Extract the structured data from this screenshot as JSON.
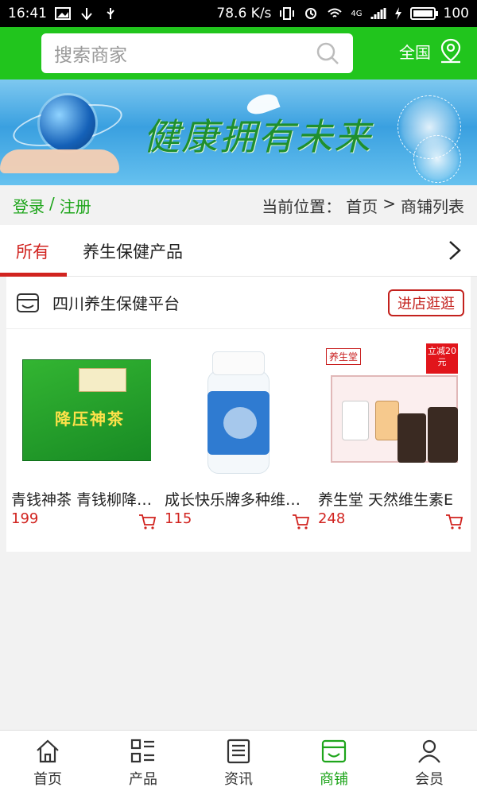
{
  "status_bar": {
    "time": "16:41",
    "speed": "78.6 K/s",
    "network": "4G",
    "battery": "100"
  },
  "header": {
    "search_placeholder": "搜索商家",
    "region_label": "全国"
  },
  "banner": {
    "slogan": "健康拥有未来"
  },
  "breadcrumb": {
    "login": "登录",
    "separator": "/",
    "register": "注册",
    "location_label": "当前位置：",
    "home": "首页",
    "arrow": ">",
    "current": "商铺列表"
  },
  "tabs": [
    {
      "label": "所有",
      "active": true
    },
    {
      "label": "养生保健产品",
      "active": false
    }
  ],
  "shop": {
    "name": "四川养生保健平台",
    "enter_button": "进店逛逛",
    "products": [
      {
        "name": "青钱神茶 青钱柳降压神茶",
        "price": "199",
        "box_text": "降压神茶"
      },
      {
        "name": "成长快乐牌多种维生素",
        "price": "115",
        "box_text": ""
      },
      {
        "name": "养生堂 天然维生素E",
        "price": "248",
        "box_text": "",
        "promo": "立减20元",
        "brand": "养生堂"
      }
    ]
  },
  "bottom_nav": [
    {
      "label": "首页",
      "icon": "home-icon",
      "active": false
    },
    {
      "label": "产品",
      "icon": "grid-list-icon",
      "active": false
    },
    {
      "label": "资讯",
      "icon": "news-icon",
      "active": false
    },
    {
      "label": "商铺",
      "icon": "store-icon",
      "active": true
    },
    {
      "label": "会员",
      "icon": "user-icon",
      "active": false
    }
  ],
  "colors": {
    "brand_green": "#21c51d",
    "accent_red": "#d1231f",
    "active_nav": "#1ea51b"
  }
}
